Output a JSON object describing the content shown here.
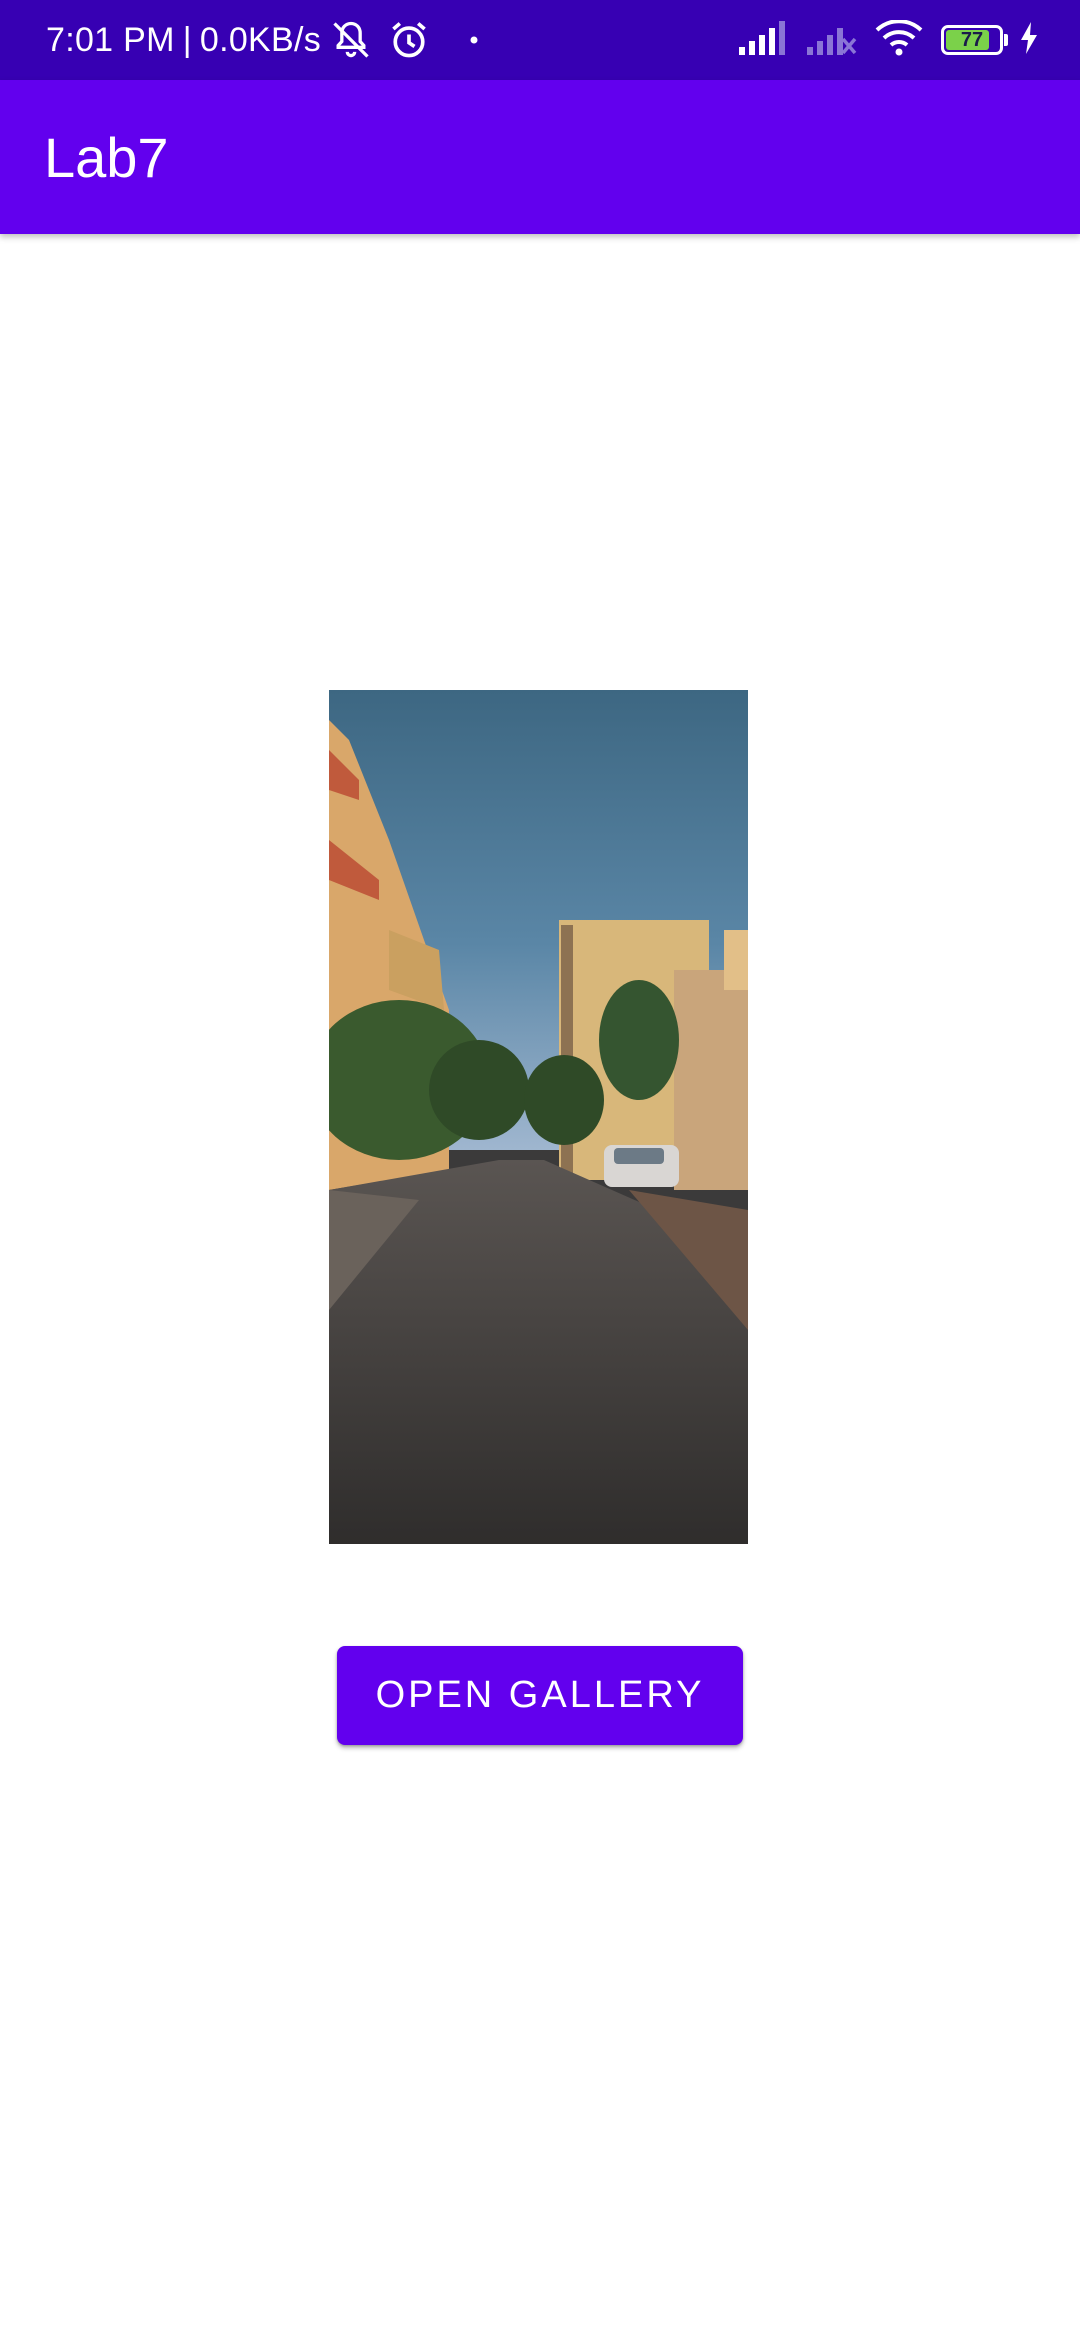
{
  "status_bar": {
    "time": "7:01 PM",
    "separator": "|",
    "network_speed": "0.0KB/s",
    "battery_level": "77",
    "icons": [
      "mute-notifications-icon",
      "alarm-icon",
      "dot-icon",
      "signal-icon",
      "signal-off-icon",
      "wifi-icon",
      "battery-icon",
      "charging-icon"
    ],
    "background_color": "#3700B3"
  },
  "app_bar": {
    "title": "Lab7",
    "background_color": "#6200EE"
  },
  "main": {
    "image": {
      "subject": "street-photo"
    },
    "open_gallery_button": {
      "label": "OPEN GALLERY",
      "color": "#6200EE"
    }
  }
}
